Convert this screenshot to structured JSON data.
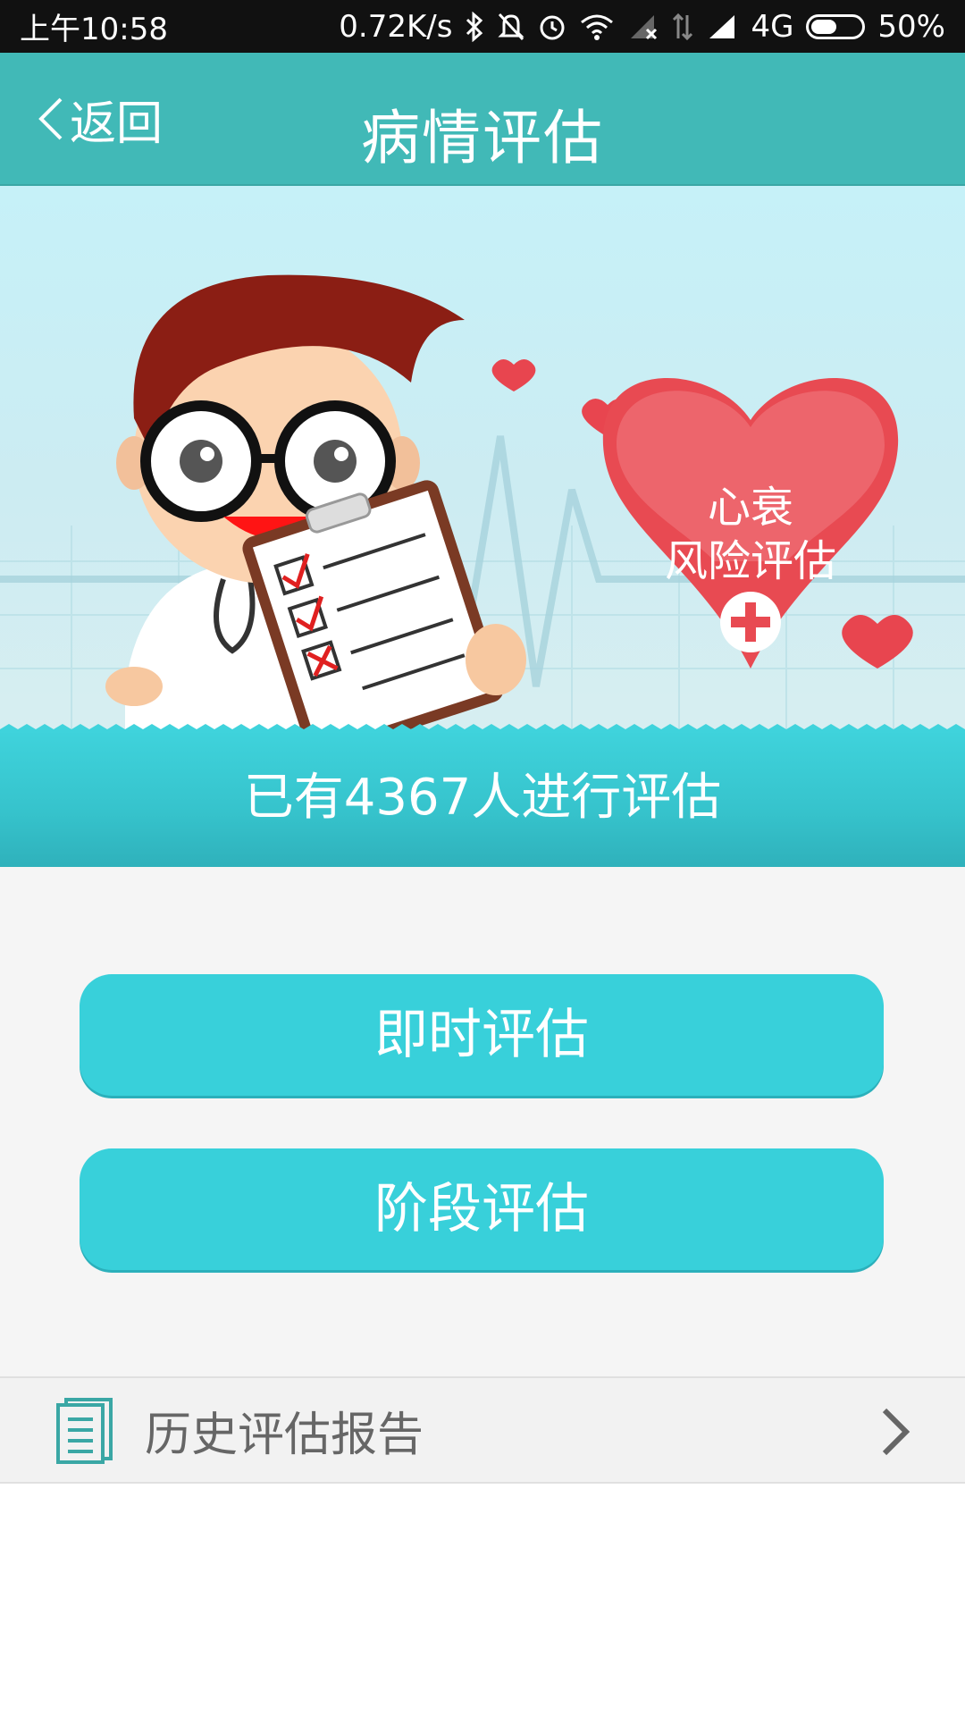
{
  "status_bar": {
    "time": "上午10:58",
    "speed": "0.72K/s",
    "network": "4G",
    "battery": "50%",
    "icons": [
      "bluetooth-icon",
      "mute-icon",
      "alarm-icon",
      "wifi-icon",
      "signal-icon",
      "data-icon",
      "signal-icon",
      "battery-icon"
    ]
  },
  "header": {
    "back_label": "返回",
    "title": "病情评估"
  },
  "banner": {
    "heart_line1": "心衰",
    "heart_line2": "风险评估"
  },
  "count_text": "已有4367人进行评估",
  "buttons": {
    "instant": "即时评估",
    "stage": "阶段评估"
  },
  "history": {
    "label": "历史评估报告"
  },
  "colors": {
    "header": "#41b9b7",
    "button": "#38d0da",
    "strip": "#36c3cc"
  }
}
